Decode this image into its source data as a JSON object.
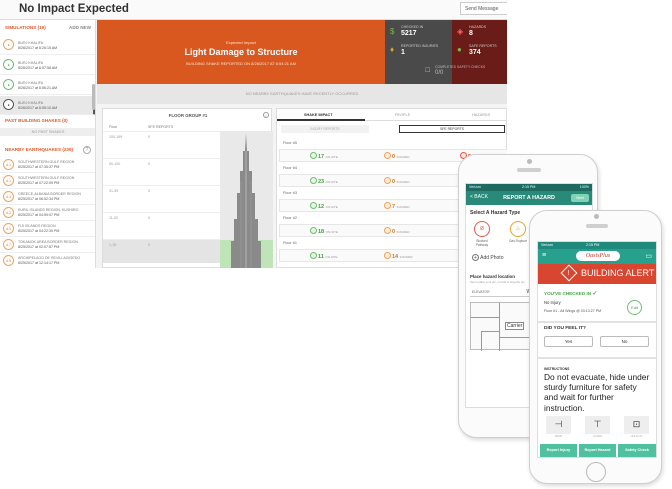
{
  "dashboard": {
    "title": "No Impact Expected",
    "send_message": "Send Message",
    "sidebar": {
      "simulations_header": "SIMULATIONS (19)",
      "add_new": "ADD NEW",
      "simulations": [
        {
          "t1": "BURJ KHALIFA",
          "t2": "8/26/2017 at 6:26:15 AM",
          "sel": false,
          "c": "o"
        },
        {
          "t1": "BURJ KHALIFA",
          "t2": "8/26/2017 at 6:57:58 AM",
          "sel": false,
          "c": "g"
        },
        {
          "t1": "BURJ KHALIFA",
          "t2": "8/26/2017 at 6:56:21 AM",
          "sel": false,
          "c": "g"
        },
        {
          "t1": "BURJ KHALIFA",
          "t2": "8/26/2017 at 6:55:10 AM",
          "sel": true,
          "c": "d"
        }
      ],
      "past_header": "PAST BUILDING SHAKES (0)",
      "past_note": "NO PAST SHAKES",
      "nearby_header": "NEARBY EARTHQUAKES (239)",
      "help_icon": "?",
      "nearby": [
        {
          "m": "4.1",
          "t1": "SOUTHWESTERN GULF REGION",
          "t2": "8/25/2017 at 07:35:37 PM"
        },
        {
          "m": "4.1",
          "t1": "SOUTHWESTERN GULF REGION",
          "t2": "8/25/2017 at 07:22:09 PM"
        },
        {
          "m": "4.3",
          "t1": "GREECE-ALBANIA BORDER REGION",
          "t2": "8/25/2017 at 06:52:34 PM"
        },
        {
          "m": "4.2",
          "t1": "KURIL ISLANDS REGION, KUSHIRO",
          "t2": "8/25/2017 at 04:59:07 PM"
        },
        {
          "m": "4.0",
          "t1": "FIJI ISLANDS REGION",
          "t2": "8/25/2017 at 04:22:30 PM"
        },
        {
          "m": "4.7",
          "t1": "TOKAMOK AREA BORDER REGION",
          "t2": "8/25/2017 at 02:07:57 PM"
        },
        {
          "m": "4.5",
          "t1": "ARCHIPELAGO DE REVILLAGIGEDO",
          "t2": "8/25/2017 at 12:14:17 PM"
        }
      ]
    },
    "banner": {
      "kicker": "Expected Impact",
      "headline": "Light Damage to Structure",
      "sub": "BUILDING SHAKE REPORTED ON 8/26/2017 AT 6:54:21 AM"
    },
    "stats": {
      "checked_in_label": "CHECKED IN",
      "checked_in_value": "5217",
      "hazards_label": "HAZARDS",
      "hazards_value": "8",
      "reported_injuries_label": "REPORTED INJURIES",
      "reported_injuries_value": "1",
      "safe_reports_label": "SAFE REPORTS",
      "safe_reports_value": "374",
      "safety_checks_label": "COMPLETED SAFETY CHECKS",
      "safety_checks_value": "0/0"
    },
    "info_strip": "NO NEARBY EARTHQUAKES HAVE RECENTLY OCCURRED",
    "floors": {
      "title": "FLOOR GROUP #1",
      "col_floor": "Floor",
      "col_reports": "SFE REPORTS",
      "rows": [
        {
          "a": "100-199",
          "b": "0"
        },
        {
          "a": "60-100",
          "b": "0"
        },
        {
          "a": "31-59",
          "b": "0"
        },
        {
          "a": "11-30",
          "b": "0"
        },
        {
          "a": "1-10",
          "b": "0"
        }
      ]
    },
    "impact": {
      "tabs": [
        "SHAKE IMPACT",
        "PEOPLE",
        "HAZARDS"
      ],
      "segment_off": "INJURY REPORTS",
      "segment_on": "SFE REPORTS",
      "rows": [
        {
          "floor": "Floor #5",
          "safe": "17",
          "injured": "0",
          "hazard": "0"
        },
        {
          "floor": "Floor #4",
          "safe": "23",
          "injured": "0",
          "hazard": "0"
        },
        {
          "floor": "Floor #3",
          "safe": "12",
          "injured": "7",
          "hazard": "0"
        },
        {
          "floor": "Floor #2",
          "safe": "18",
          "injured": "0",
          "hazard": "0"
        },
        {
          "floor": "Floor #1",
          "safe": "11",
          "injured": "14",
          "hazard": "0"
        }
      ],
      "safe_label": "ON-SITE",
      "injured_label": "INJURED",
      "hazard_label": "SFE REPORTS"
    }
  },
  "phone_hazard": {
    "carrier": "Verizon",
    "time": "2:15 PM",
    "battery": "100%",
    "back": "< BACK",
    "title": "REPORT A HAZARD",
    "next": "Next",
    "select_heading": "Select A Hazard Type",
    "hazards": [
      "Blocked Pathway",
      "Gas Rupture"
    ],
    "add_photo": "Add Photo",
    "place_heading": "Place hazard location",
    "place_sub": "Tap to place your pin, or hold to drag the pin.",
    "elevator_label": "ELEVATOR",
    "floor_value": "W2",
    "plan_label": "Carrier"
  },
  "phone_alert": {
    "carrier": "Verizon",
    "time": "2:15 PM",
    "logo": "OasisPlus",
    "alert": "BUILDING ALERT",
    "checked_in": "YOU'VE CHECKED IN",
    "no_injury": "No Injury",
    "location": "Floor #1 - All Wings @ 03:13:27 PM",
    "edit": "Edit",
    "did_you_feel": "DID YOU FEEL IT?",
    "yes": "Yes",
    "no": "No",
    "instructions_heading": "INSTRUCTIONS",
    "instructions": "Do not evacuate, hide under sturdy furniture for safety and wait for further instruction.",
    "illustrations": [
      "DROP",
      "COVER",
      "HOLD ON"
    ],
    "buttons": [
      "Report Injury",
      "Report Hazard",
      "Safety Check"
    ]
  },
  "colors": {
    "banner_orange": "#d9581f",
    "stats_grey": "#4a4a4a",
    "hazard_red": "#6a1c18",
    "teal": "#27a08e",
    "alert_red": "#d9462f",
    "action_green": "#4fc0a0"
  }
}
